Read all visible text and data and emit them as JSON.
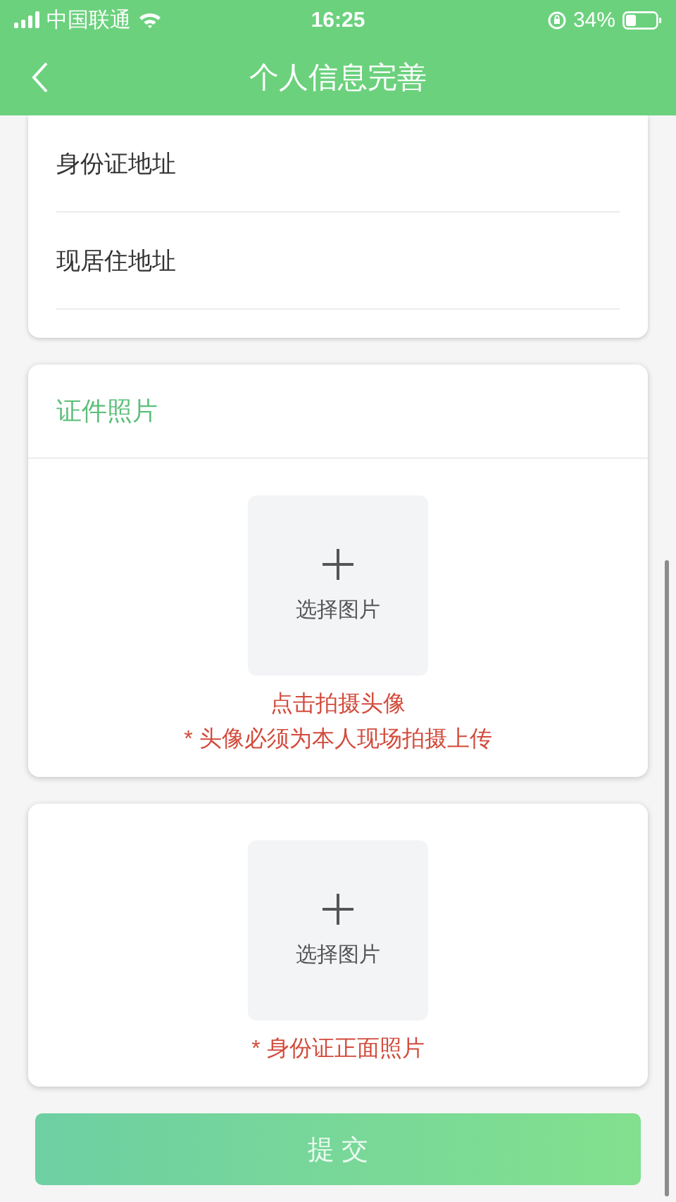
{
  "status_bar": {
    "carrier": "中国联通",
    "time": "16:25",
    "battery": "34%"
  },
  "nav_bar": {
    "title": "个人信息完善"
  },
  "address_card": {
    "fields": [
      {
        "label": "身份证地址"
      },
      {
        "label": "现居住地址"
      }
    ]
  },
  "photo_cards": [
    {
      "title": "证件照片",
      "upload": {
        "label": "选择图片"
      },
      "notes": [
        "点击拍摄头像",
        "* 头像必须为本人现场拍摄上传"
      ]
    },
    {
      "upload": {
        "label": "选择图片"
      },
      "notes": [
        "* 身份证正面照片"
      ]
    }
  ],
  "submit_button": {
    "label": "提 交"
  }
}
